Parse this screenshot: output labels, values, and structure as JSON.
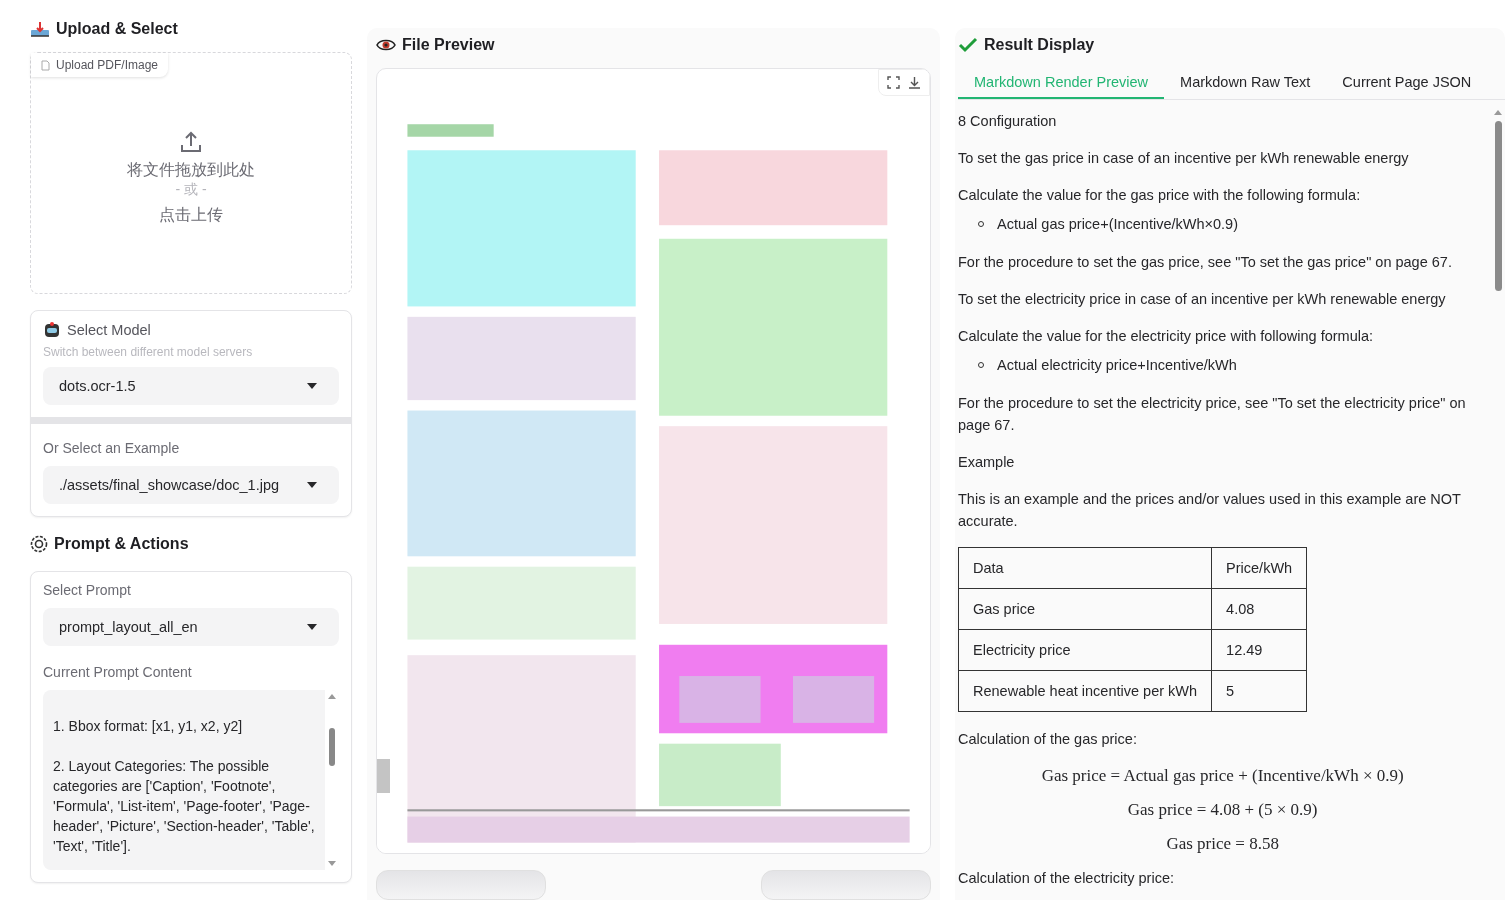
{
  "upload": {
    "title": "Upload & Select",
    "tab": "Upload PDF/Image",
    "drop_text": "将文件拖放到此处",
    "or_text": "- 或 -",
    "click_text": "点击上传"
  },
  "model": {
    "label": "Select Model",
    "hint": "Switch between different model servers",
    "value": "dots.ocr-1.5",
    "example_label": "Or Select an Example",
    "example_value": "./assets/final_showcase/doc_1.jpg"
  },
  "prompt": {
    "title": "Prompt & Actions",
    "label": "Select Prompt",
    "value": "prompt_layout_all_en",
    "content_label": "Current Prompt Content",
    "content": "1. Bbox format: [x1, y1, x2, y2]\n\n2. Layout Categories: The possible categories are ['Caption', 'Footnote', 'Formula', 'List-item', 'Page-footer', 'Page-header', 'Picture', 'Section-header', 'Table', 'Text', 'Title']."
  },
  "preview": {
    "title": "File Preview"
  },
  "result": {
    "title": "Result Display",
    "tabs": [
      {
        "label": "Markdown Render Preview",
        "selected": true
      },
      {
        "label": "Markdown Raw Text",
        "selected": false
      },
      {
        "label": "Current Page JSON",
        "selected": false
      }
    ],
    "blocks": [
      {
        "kind": "paragraph",
        "text": "8 Configuration"
      },
      {
        "kind": "paragraph",
        "text": "To set the gas price in case of an incentive per kWh renewable energy"
      },
      {
        "kind": "paragraph",
        "text": "Calculate the value for the gas price with the following formula:"
      },
      {
        "kind": "list_item",
        "text": "Actual gas price+(Incentive/kWh×0.9)"
      },
      {
        "kind": "paragraph",
        "text": "For the procedure to set the gas price, see \"To set the gas price\" on page 67."
      },
      {
        "kind": "paragraph",
        "text": "To set the electricity price in case of an incentive per kWh renewable energy"
      },
      {
        "kind": "paragraph",
        "text": "Calculate the value for the electricity price with following formula:"
      },
      {
        "kind": "list_item",
        "text": "Actual electricity price+Incentive/kWh"
      },
      {
        "kind": "paragraph",
        "text": "For the procedure to set the electricity price, see \"To set the electricity price\" on page 67."
      },
      {
        "kind": "paragraph",
        "text": "Example"
      },
      {
        "kind": "paragraph",
        "text": "This is an example and the prices and/or values used in this example are NOT accurate."
      },
      {
        "kind": "table",
        "rows": [
          [
            "Data",
            "Price/kWh"
          ],
          [
            "Gas price",
            "4.08"
          ],
          [
            "Electricity price",
            "12.49"
          ],
          [
            "Renewable heat incentive per kWh",
            "5"
          ]
        ]
      },
      {
        "kind": "paragraph",
        "text": "Calculation of the gas price:"
      },
      {
        "kind": "formula",
        "text": "Gas price = Actual gas price + (Incentive/kWh × 0.9)"
      },
      {
        "kind": "formula",
        "text": "Gas price = 4.08 + (5 × 0.9)"
      },
      {
        "kind": "formula",
        "text": "Gas price = 8.58"
      },
      {
        "kind": "paragraph",
        "text": "Calculation of the electricity price:"
      }
    ]
  }
}
